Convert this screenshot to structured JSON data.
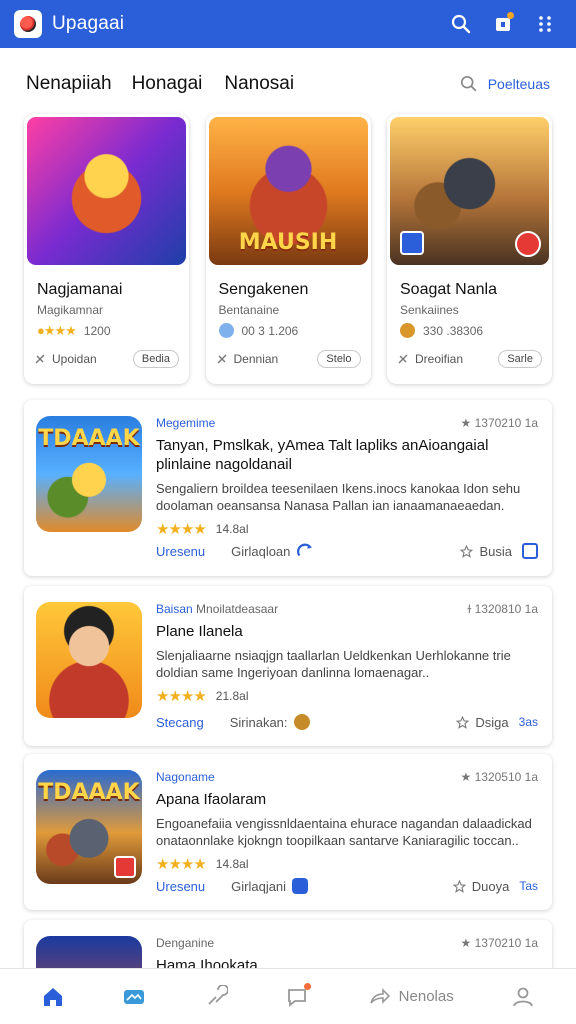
{
  "app": {
    "title": "Upagaai"
  },
  "tabs": [
    "Nenapiiah",
    "Honagai",
    "Nanosai"
  ],
  "search_link": "Poelteuas",
  "featured": [
    {
      "name": "Nagjamanai",
      "subtitle": "Magikamnar",
      "rating_text": "1200",
      "action": "Upoidan",
      "pill": "Bedia"
    },
    {
      "name": "Sengakenen",
      "subtitle": "Bentanaine",
      "rating_text": "00 3 1.206",
      "action": "Dennian",
      "pill": "Stelo",
      "logo": "MAUSIH"
    },
    {
      "name": "Soagat Nanla",
      "subtitle": "Senkaiines",
      "rating_text": "330 .38306",
      "action": "Dreoifian",
      "pill": "Sarle"
    }
  ],
  "list": [
    {
      "category": "Megemime",
      "meta": "1370210  1a",
      "title": "Tanyan, Pmslkak, yAmea Talt lapliks anAioangaial plinlaine nagoldanail",
      "desc": "Sengaliern broildea teesenilaen Ikens.inocs kanokaa Idon sehu doolaman oeansansa Nanasa Pallan ian ianaamanaeaedan.",
      "rating": "14.8al",
      "stars": 4,
      "primary": "Uresenu",
      "secondary": "Girlaqloan",
      "right_label": "Busia",
      "icon_tag": "TDAAAK"
    },
    {
      "category": "Baisan",
      "category_extra": "Mnoilatdeasaar",
      "meta": "1320810  1a",
      "title": "Plane Ilanela",
      "desc": "Slenjaliaarne nsiaqjgn taallarlan Ueldkenkan Uerhlokanne trie doldian same Ingeriyoan danlinna lomaenagar..",
      "rating": "21.8al",
      "stars": 4,
      "primary": "Stecang",
      "secondary": "Sirinakan:",
      "right_label": "Dsiga",
      "right_badge": "3as"
    },
    {
      "category": "Nagoname",
      "meta": "1320510  1a",
      "title": "Apana Ifaolaram",
      "desc": "Engoanefaiia vengissnldaentaina ehurace nagandan dalaadickad onataonnlake kjokngn toopilkaan santarve Kaniaragilic toccan..",
      "rating": "14.8al",
      "stars": 4,
      "primary": "Uresenu",
      "secondary": "Girlaqjani",
      "right_label": "Duoya",
      "right_badge": "Tas",
      "icon_tag": "TDAAAK"
    },
    {
      "category": "Denganine",
      "meta": "1370210  1a",
      "title": "Hama Ihookata"
    }
  ],
  "bottom_nav": {
    "messages_label": "Nenolas"
  },
  "colors": {
    "primary": "#2b5fd9",
    "star": "#f2b01e"
  },
  "icons": [
    "search-icon",
    "bell-icon",
    "more-icon",
    "home-icon",
    "image-icon",
    "pin-icon",
    "chat-icon",
    "share-icon",
    "user-icon",
    "star-icon"
  ]
}
